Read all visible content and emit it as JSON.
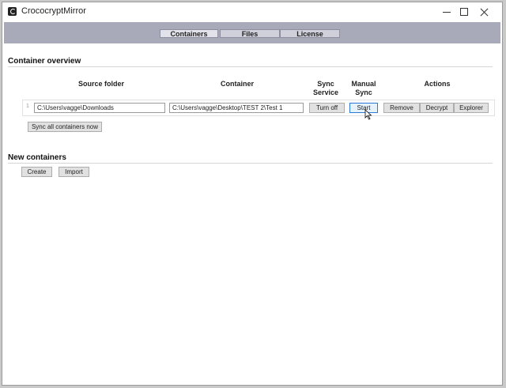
{
  "window": {
    "title": "CrococryptMirror",
    "minimize_glyph": "",
    "maximize_glyph": "",
    "close_glyph": ""
  },
  "tabs": [
    {
      "label": "Containers",
      "active": true
    },
    {
      "label": "Files",
      "active": false
    },
    {
      "label": "License",
      "active": false
    }
  ],
  "overview": {
    "title": "Container overview",
    "headers": {
      "source_folder": "Source folder",
      "container": "Container",
      "sync_service": "Sync Service",
      "manual_sync": "Manual Sync",
      "actions": "Actions"
    },
    "rows": [
      {
        "index": "1",
        "source": "C:\\Users\\vagge\\Downloads",
        "container": "C:\\Users\\vagge\\Desktop\\TEST 2\\Test 1",
        "sync_button": "Turn off",
        "manual_button": "Start",
        "remove_button": "Remove",
        "decrypt_button": "Decrypt",
        "explorer_button": "Explorer"
      }
    ],
    "sync_all_button": "Sync all containers now"
  },
  "new_containers": {
    "title": "New containers",
    "create_button": "Create",
    "import_button": "Import"
  },
  "colors": {
    "tab_bar": "#a9aab9",
    "focus_border": "#2a7ad6"
  }
}
